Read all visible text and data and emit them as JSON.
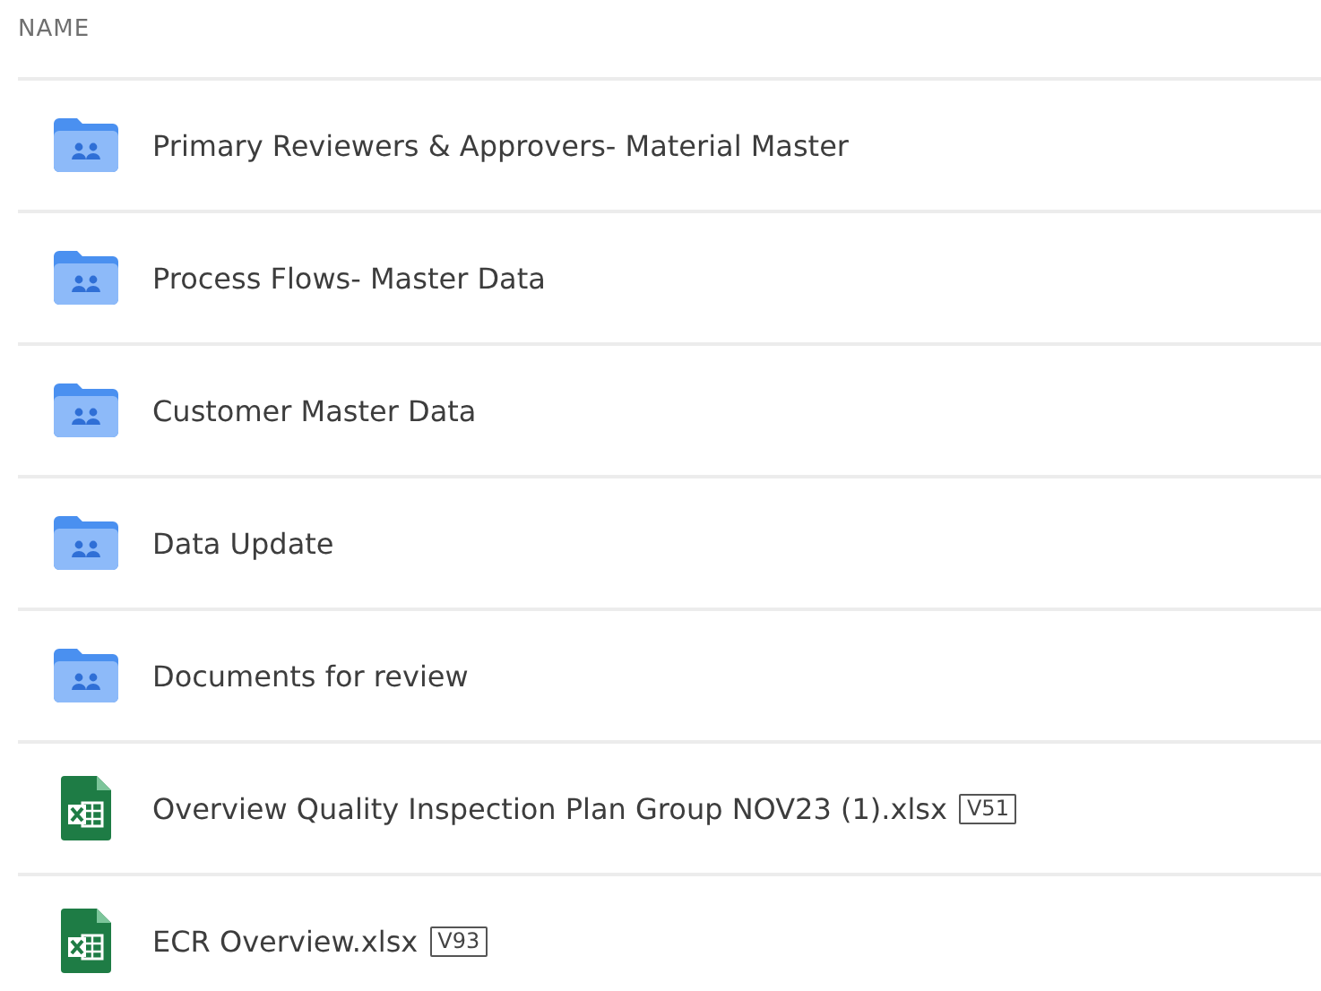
{
  "table": {
    "columns": [
      {
        "label": "NAME"
      }
    ],
    "rows": [
      {
        "kind": "folder",
        "name": "Primary Reviewers & Approvers- Material Master"
      },
      {
        "kind": "folder",
        "name": "Process Flows- Master Data"
      },
      {
        "kind": "folder",
        "name": "Customer Master Data"
      },
      {
        "kind": "folder",
        "name": "Data Update"
      },
      {
        "kind": "folder",
        "name": "Documents for review"
      },
      {
        "kind": "spreadsheet",
        "name": "Overview Quality Inspection Plan Group NOV23 (1).xlsx",
        "version": "V51"
      },
      {
        "kind": "spreadsheet",
        "name": "ECR Overview.xlsx",
        "version": "V93"
      }
    ]
  }
}
